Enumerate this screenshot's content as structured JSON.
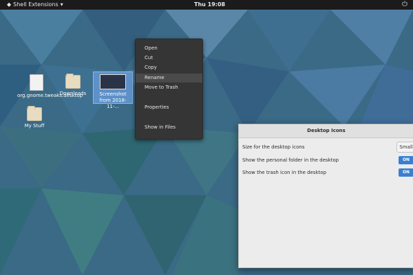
{
  "topbar": {
    "app_menu": "Shell Extensions",
    "clock": "Thu 19:08"
  },
  "desktop": {
    "icons": [
      {
        "label": "org.gnome.tweaks.desktop"
      },
      {
        "label": "Downloads"
      },
      {
        "label": "Screenshot from 2018-11-..."
      },
      {
        "label": "My Stuff"
      }
    ]
  },
  "context_menu": {
    "items": [
      "Open",
      "Cut",
      "Copy",
      "Rename",
      "Move to Trash",
      "Properties",
      "Show in Files"
    ],
    "highlighted": "Rename"
  },
  "dialog": {
    "title": "Desktop Icons",
    "size_label": "Size for the desktop icons",
    "size_value": "Small",
    "personal_folder_label": "Show the personal folder in the desktop",
    "personal_folder_state": "ON",
    "trash_label": "Show the trash icon in the desktop",
    "trash_state": "ON"
  },
  "colors": {
    "accent": "#3b7fd0",
    "topbar": "#1b1b1b",
    "menu_bg": "#353535"
  }
}
